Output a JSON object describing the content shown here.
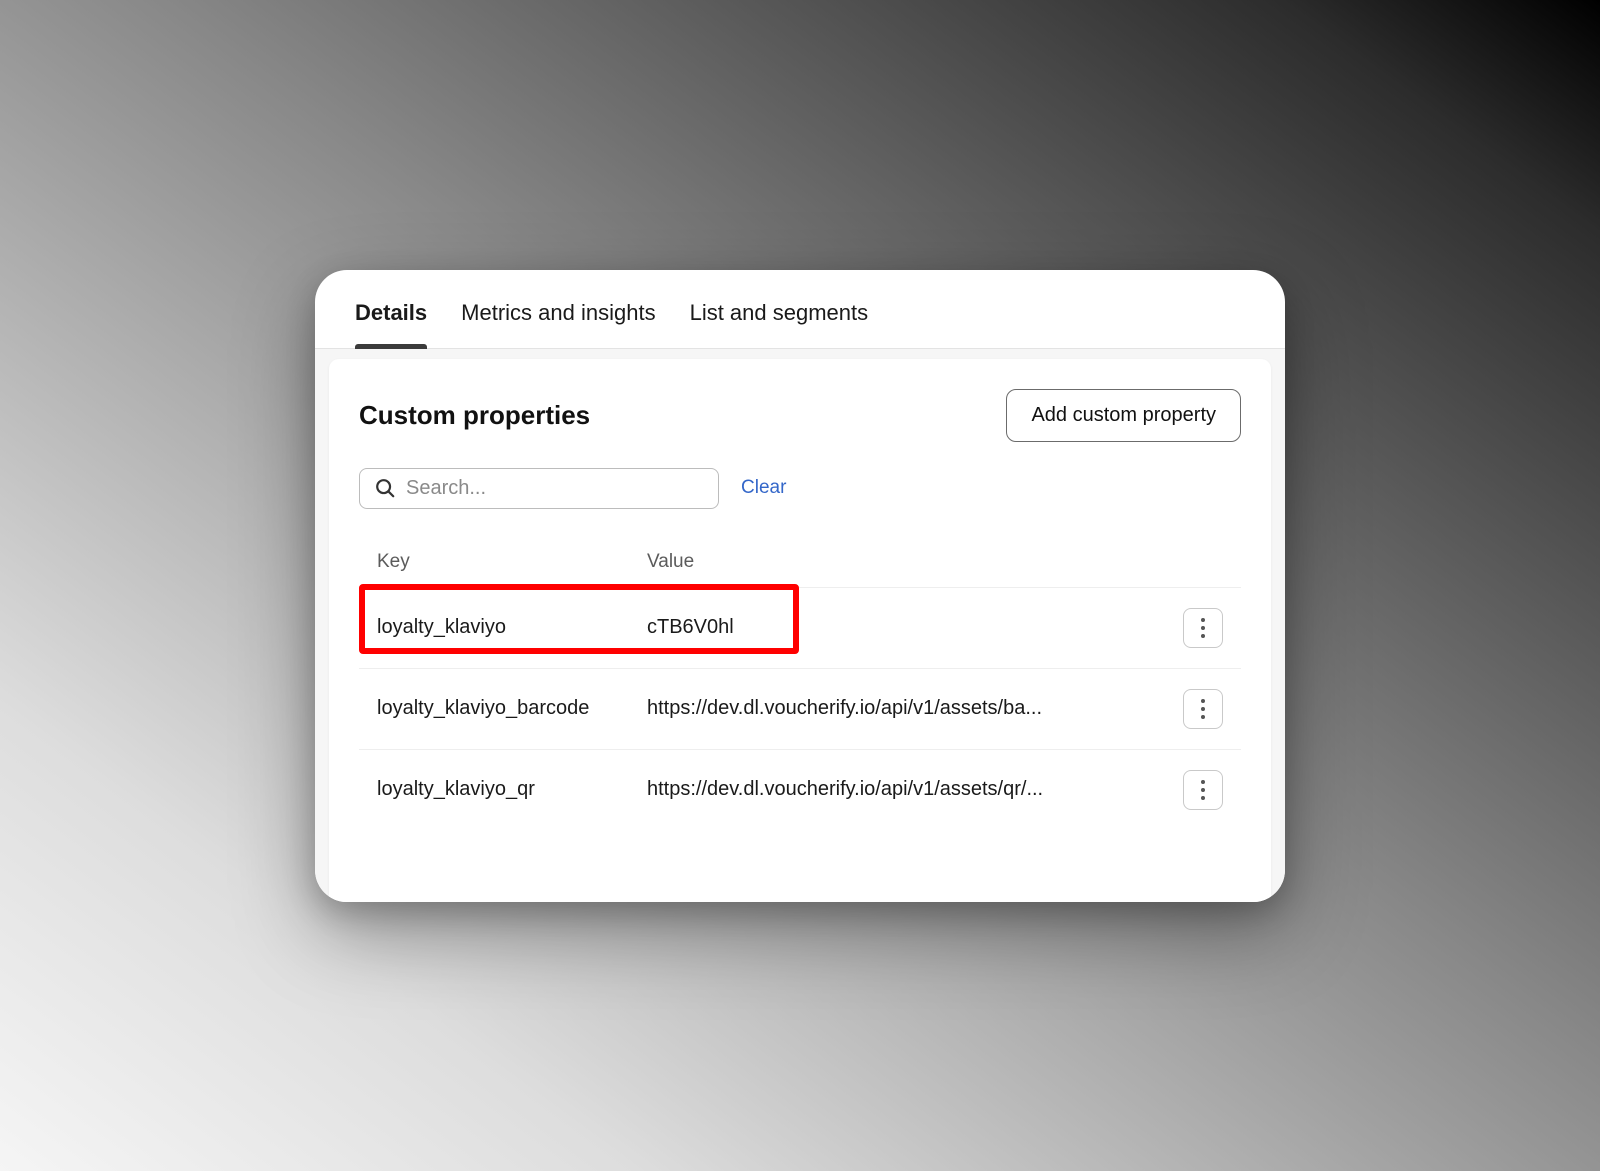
{
  "tabs": [
    {
      "label": "Details",
      "active": true
    },
    {
      "label": "Metrics and insights",
      "active": false
    },
    {
      "label": "List and segments",
      "active": false
    }
  ],
  "card": {
    "title": "Custom properties",
    "add_button": "Add custom property"
  },
  "search": {
    "placeholder": "Search...",
    "clear_label": "Clear"
  },
  "table": {
    "headers": {
      "key": "Key",
      "value": "Value"
    },
    "rows": [
      {
        "key": "loyalty_klaviyo",
        "value": "cTB6V0hl",
        "highlight": true
      },
      {
        "key": "loyalty_klaviyo_barcode",
        "value": "https://dev.dl.voucherify.io/api/v1/assets/ba...",
        "highlight": false
      },
      {
        "key": "loyalty_klaviyo_qr",
        "value": "https://dev.dl.voucherify.io/api/v1/assets/qr/...",
        "highlight": false
      }
    ]
  }
}
